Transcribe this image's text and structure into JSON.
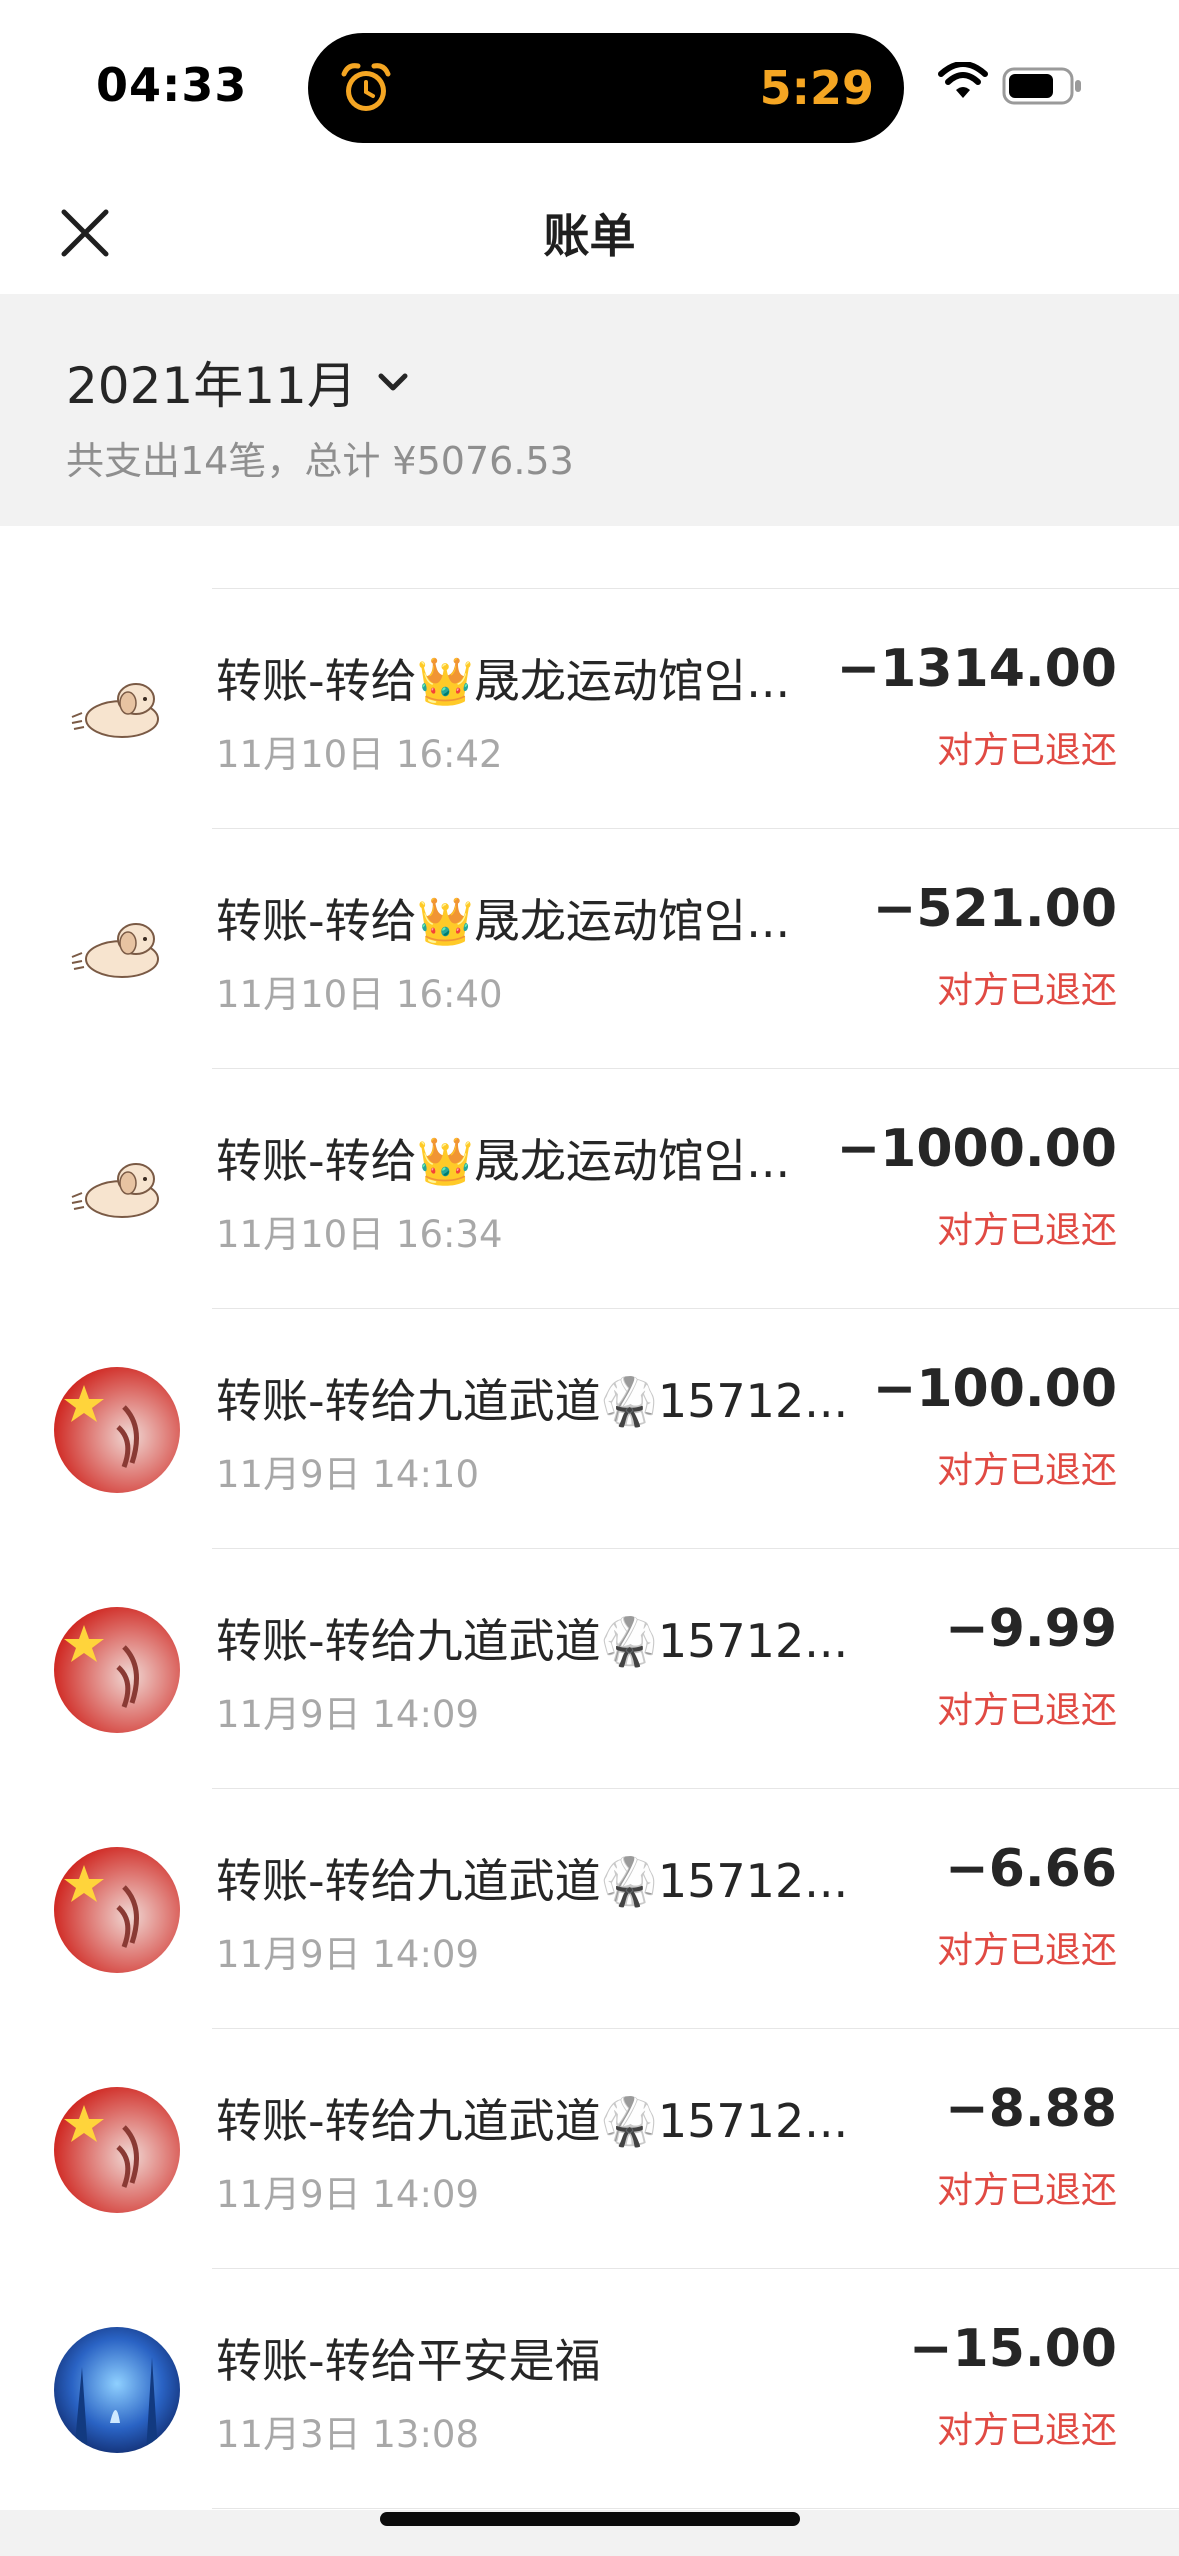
{
  "status_bar": {
    "time": "04:33",
    "island_time": "5:29",
    "icons": [
      "alarm-icon",
      "wifi-icon",
      "battery-icon"
    ]
  },
  "nav": {
    "title": "账单",
    "close_icon": "close-icon"
  },
  "summary": {
    "month": "2021年11月",
    "text": "共支出14笔，总计 ¥5076.53"
  },
  "transactions": [
    {
      "title": "转账-转给👑晟龙运动馆임...",
      "time": "11月10日 16:42",
      "amount": "−1314.00",
      "status": "对方已退还",
      "avatar": "puppy-avatar"
    },
    {
      "title": "转账-转给👑晟龙运动馆임...",
      "time": "11月10日 16:40",
      "amount": "−521.00",
      "status": "对方已退还",
      "avatar": "puppy-avatar"
    },
    {
      "title": "转账-转给👑晟龙运动馆임...",
      "time": "11月10日 16:34",
      "amount": "−1000.00",
      "status": "对方已退还",
      "avatar": "puppy-avatar"
    },
    {
      "title": "转账-转给九道武道🥋15712...",
      "time": "11月9日 14:10",
      "amount": "−100.00",
      "status": "对方已退还",
      "avatar": "flag-avatar"
    },
    {
      "title": "转账-转给九道武道🥋15712...",
      "time": "11月9日 14:09",
      "amount": "−9.99",
      "status": "对方已退还",
      "avatar": "flag-avatar"
    },
    {
      "title": "转账-转给九道武道🥋15712...",
      "time": "11月9日 14:09",
      "amount": "−6.66",
      "status": "对方已退还",
      "avatar": "flag-avatar"
    },
    {
      "title": "转账-转给九道武道🥋15712...",
      "time": "11月9日 14:09",
      "amount": "−8.88",
      "status": "对方已退还",
      "avatar": "flag-avatar"
    },
    {
      "title": "转账-转给平安是福",
      "time": "11月3日 13:08",
      "amount": "−15.00",
      "status": "对方已退还",
      "avatar": "blue-forest-avatar"
    }
  ],
  "colors": {
    "status_red": "#e04a43",
    "island_orange": "#f5a623",
    "summary_bg": "#f2f2f2"
  }
}
